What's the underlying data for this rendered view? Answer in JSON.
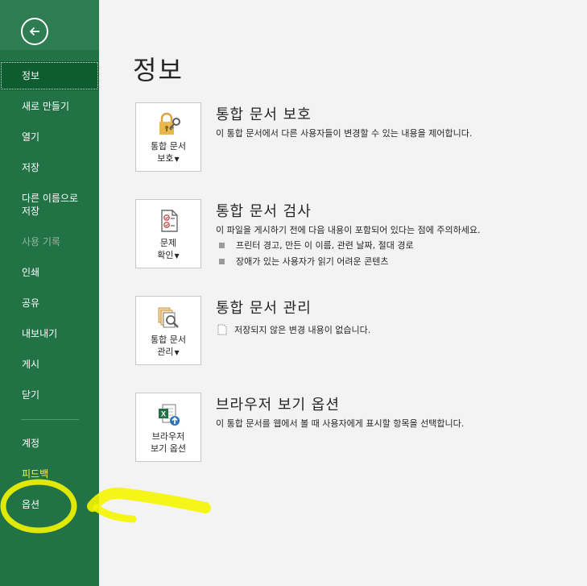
{
  "sidebar": {
    "back_label": "",
    "items": [
      {
        "label": "정보"
      },
      {
        "label": "새로 만들기"
      },
      {
        "label": "열기"
      },
      {
        "label": "저장"
      },
      {
        "label": "다른 이름으로\n저장"
      },
      {
        "label": "사용 기록"
      },
      {
        "label": "인쇄"
      },
      {
        "label": "공유"
      },
      {
        "label": "내보내기"
      },
      {
        "label": "게시"
      },
      {
        "label": "닫기"
      },
      {
        "label": "계정"
      },
      {
        "label": "피드백"
      },
      {
        "label": "옵션"
      }
    ]
  },
  "main": {
    "title": "정보",
    "sections": [
      {
        "tile_line1": "통합 문서",
        "tile_line2": "보호",
        "title": "통합 문서 보호",
        "desc": "이 통합 문서에서 다른 사용자들이 변경할 수 있는 내용을 제어합니다."
      },
      {
        "tile_line1": "문제",
        "tile_line2": "확인",
        "title": "통합 문서 검사",
        "desc": "이 파일을 게시하기 전에 다음 내용이 포함되어 있다는 점에 주의하세요.",
        "bullets": [
          "프린터 경고, 만든 이 이름, 관련 날짜, 절대 경로",
          "장애가 있는 사용자가 읽기 어려운 콘텐츠"
        ]
      },
      {
        "tile_line1": "통합 문서",
        "tile_line2": "관리",
        "title": "통합 문서 관리",
        "bullets": [
          "저장되지 않은 변경 내용이 없습니다."
        ]
      },
      {
        "tile_line1": "브라우저",
        "tile_line2": "보기 옵션",
        "title": "브라우저 보기 옵션",
        "desc": "이 통합 문서를 웹에서 볼 때 사용자에게 표시할 항목을 선택합니다."
      }
    ]
  },
  "colors": {
    "sidebar_bg": "#217346",
    "sidebar_active": "#0e5c2f",
    "annotation": "#f5f500",
    "feedback_text": "#fff34d"
  }
}
